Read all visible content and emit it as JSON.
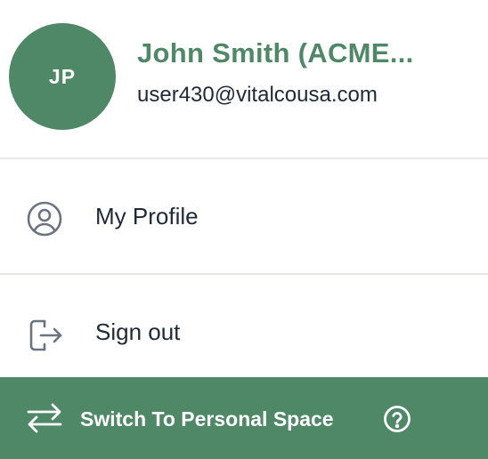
{
  "user": {
    "initials": "JP",
    "name": "John Smith (ACME...",
    "email": "user430@vitalcousa.com"
  },
  "menu": {
    "items": [
      {
        "label": "My Profile",
        "icon": "user-circle-icon"
      },
      {
        "label": "Sign out",
        "icon": "sign-out-icon"
      }
    ]
  },
  "footer": {
    "label": "Switch To Personal Space",
    "switch_icon": "swap-arrows-icon",
    "help_icon": "help-circle-icon"
  },
  "colors": {
    "accent": "#4f8866",
    "text": "#1f2937",
    "icon": "#6b7280",
    "divider": "#e5e7eb"
  }
}
